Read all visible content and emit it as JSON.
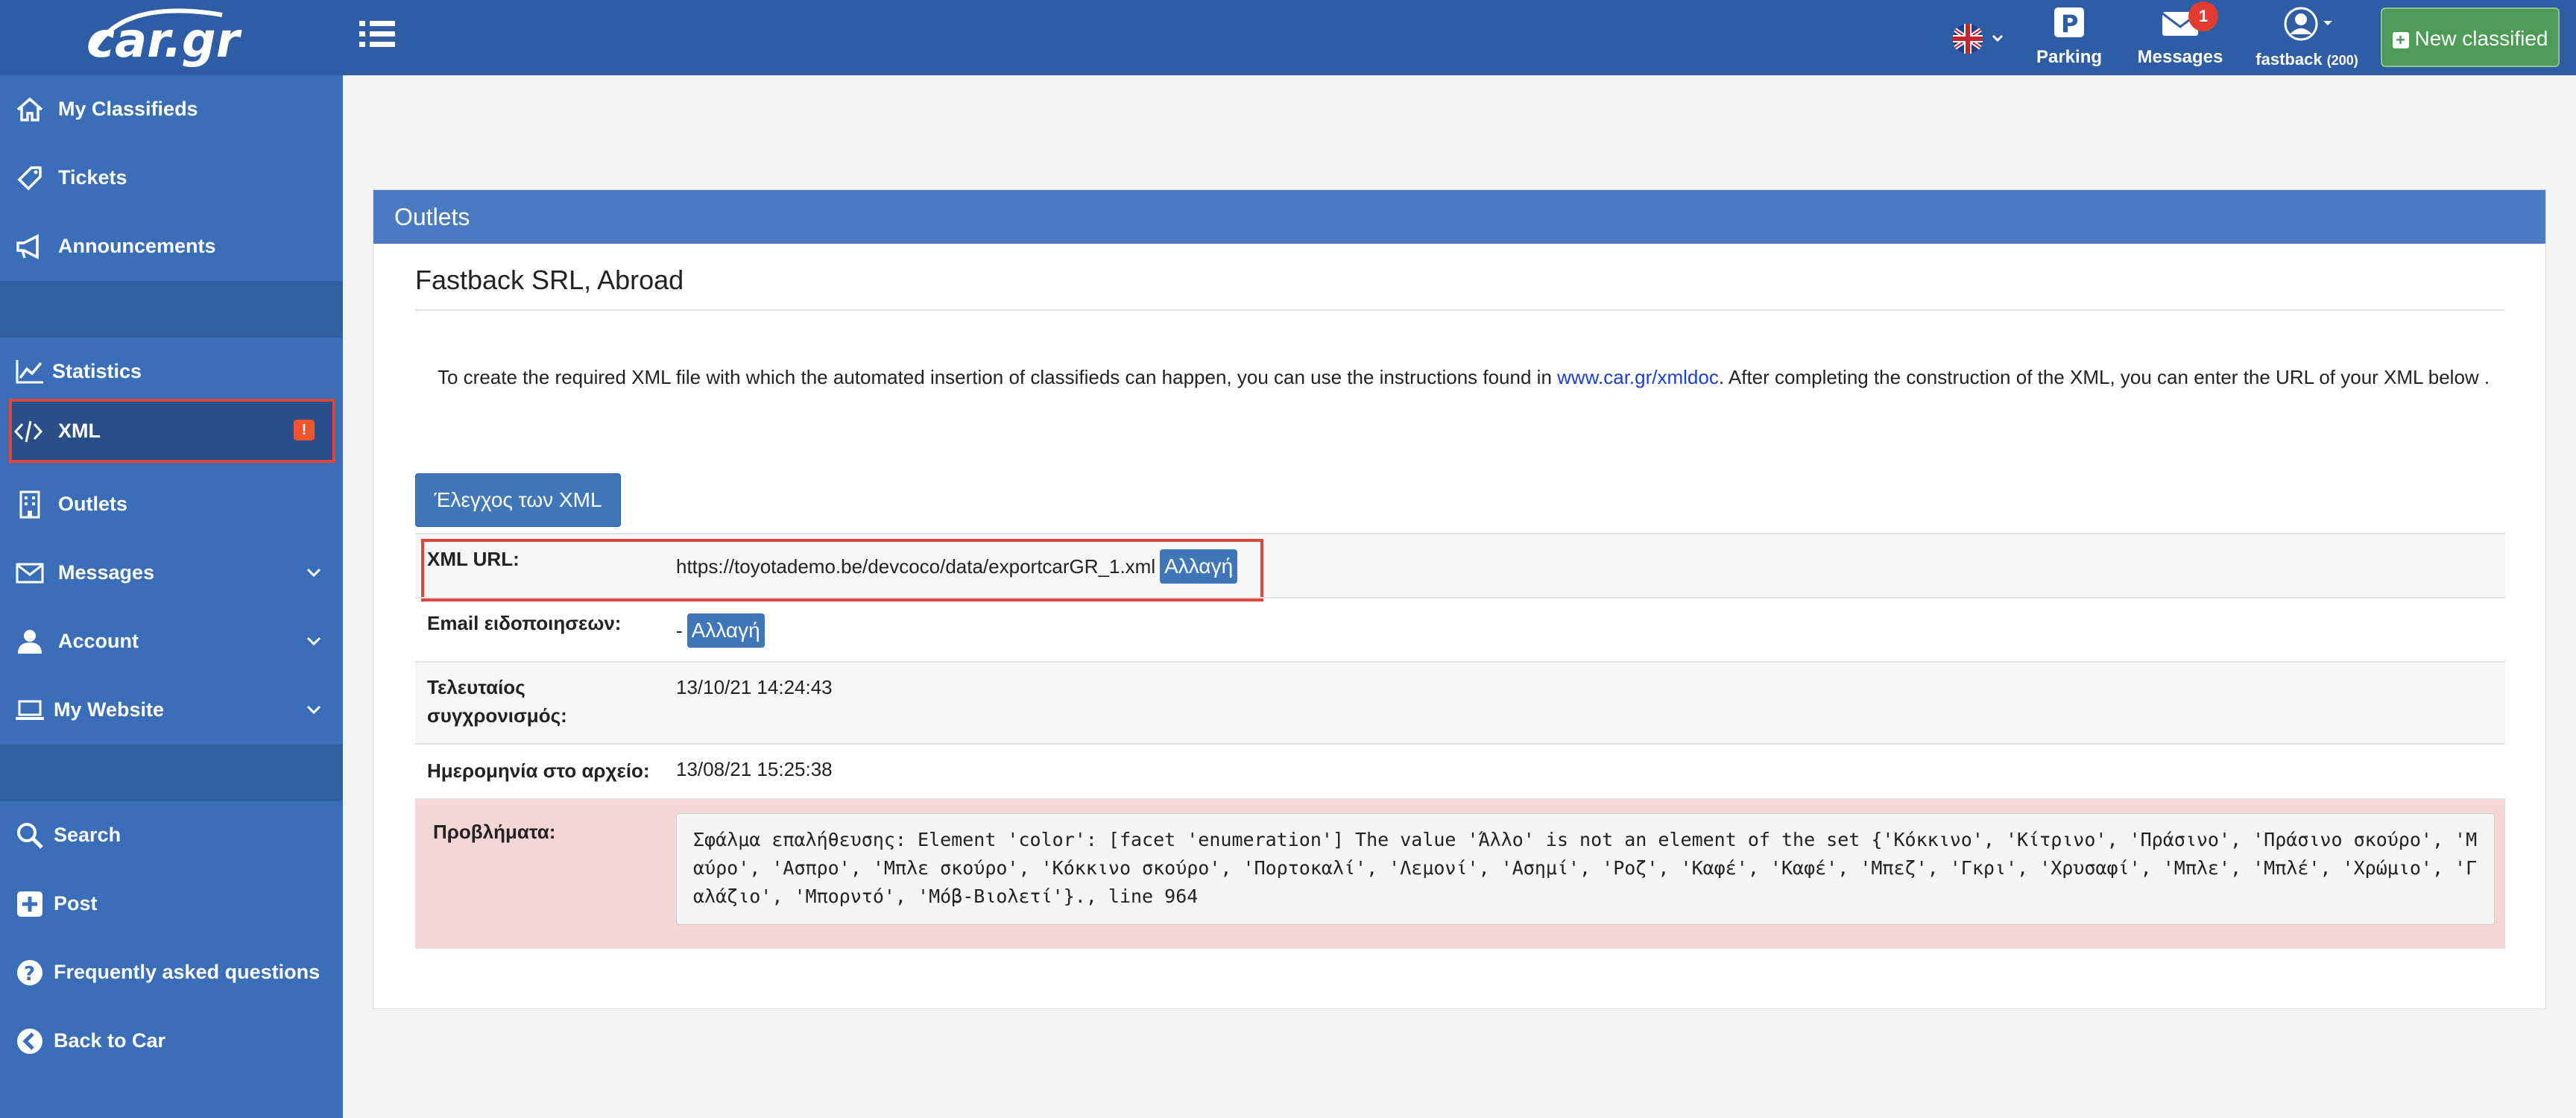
{
  "header": {
    "logo_text": "car.gr",
    "parking_label": "Parking",
    "messages_label": "Messages",
    "messages_count": "1",
    "user_name": "fastback",
    "user_count": "(200)",
    "new_classified_label": "New classified"
  },
  "sidebar": {
    "items": [
      {
        "label": "My Classifieds",
        "icon": "home-icon"
      },
      {
        "label": "Tickets",
        "icon": "ticket-icon"
      },
      {
        "label": "Announcements",
        "icon": "megaphone-icon"
      },
      {
        "label": "Statistics",
        "icon": "chart-line-icon"
      },
      {
        "label": "XML",
        "icon": "code-icon",
        "badge": "!"
      },
      {
        "label": "Outlets",
        "icon": "building-icon"
      },
      {
        "label": "Messages",
        "icon": "envelope-icon"
      },
      {
        "label": "Account",
        "icon": "user-icon"
      },
      {
        "label": "My Website",
        "icon": "laptop-icon"
      },
      {
        "label": "Search",
        "icon": "search-icon"
      },
      {
        "label": "Post",
        "icon": "plus-square-icon"
      },
      {
        "label": "Frequently asked questions",
        "icon": "question-circle-icon"
      },
      {
        "label": "Back to Car",
        "icon": "arrow-left-circle-icon"
      }
    ]
  },
  "panel": {
    "title": "Outlets",
    "outlet_name": "Fastback SRL, Abroad",
    "intro_before_link": "To create the required XML file with which the automated insertion of classifieds can happen, you can use the instructions found in ",
    "intro_link": "www.car.gr/xmldoc",
    "intro_after_link": ". After completing the construction of the XML, you can enter the URL of your XML below .",
    "check_button": "Έλεγχος των XML",
    "rows": {
      "xml_url_label": "XML URL:",
      "xml_url_value": "https://toyotademo.be/devcoco/data/exportcarGR_1.xml",
      "change_label": "Αλλαγή",
      "email_label": "Email ειδοποιησεων:",
      "email_value": "-",
      "last_sync_label_1": "Τελευταίος",
      "last_sync_label_2": "συγχρονισμός:",
      "last_sync_value": "13/10/21 14:24:43",
      "file_date_label": "Ημερομηνία στο αρχείο:",
      "file_date_value": "13/08/21 15:25:38",
      "problems_label": "Προβλήματα:",
      "problems_value": "Σφάλμα επαλήθευσης: Element 'color': [facet 'enumeration'] The value 'Άλλο' is not an element of the set {'Κόκκινο', 'Κίτρινο', 'Πράσινο', 'Πράσινο σκούρο', 'Μαύρο', 'Ασπρο', 'Μπλε σκούρο', 'Κόκκινο σκούρο', 'Πορτοκαλί', 'Λεμονί', 'Ασημί', 'Ροζ', 'Καφέ', 'Καφέ', 'Μπεζ', 'Γκρι', 'Χρυσαφί', 'Μπλε', 'Μπλέ', 'Χρώμιο', 'Γαλάζιο', 'Μπορντό', 'Μόβ-Βιολετί'}., line 964"
    }
  },
  "colors": {
    "topbar": "#2e5da6",
    "sidebar": "#3a6eb8",
    "panel_header": "#4a7bc0",
    "highlight": "#e0453a",
    "error_row": "#f5d6d6",
    "new_button": "#4e9a57"
  }
}
